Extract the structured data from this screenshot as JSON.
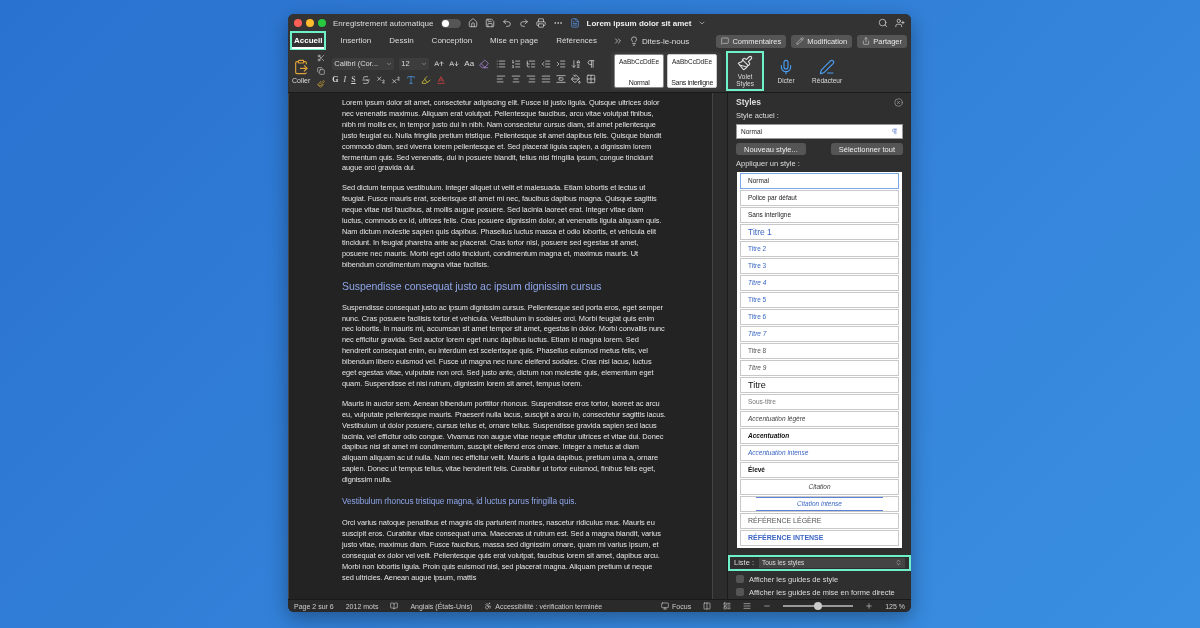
{
  "window": {
    "title": "Lorem ipsum dolor sit amet",
    "autosave_label": "Enregistrement automatique",
    "autosave_on": false
  },
  "ribbon_tabs": [
    {
      "label": "Accueil",
      "selected": true,
      "highlighted": true
    },
    {
      "label": "Insertion",
      "selected": false,
      "highlighted": false
    },
    {
      "label": "Dessin",
      "selected": false,
      "highlighted": false
    },
    {
      "label": "Conception",
      "selected": false,
      "highlighted": false
    },
    {
      "label": "Mise en page",
      "selected": false,
      "highlighted": false
    },
    {
      "label": "Références",
      "selected": false,
      "highlighted": false
    }
  ],
  "tell_me": "Dites-le-nous",
  "actions": [
    {
      "kind": "comments",
      "label": "Commentaires"
    },
    {
      "kind": "edit",
      "label": "Modification"
    },
    {
      "kind": "share",
      "label": "Partager"
    }
  ],
  "ribbon": {
    "paste_label": "Coller",
    "font_name": "Calibri (Cor...",
    "font_size": "12",
    "case_label": "Aa",
    "format_letters": [
      "G",
      "I",
      "S"
    ],
    "gallery": [
      {
        "preview": "AaBbCcDdEe",
        "label": "Normal",
        "selected": true
      },
      {
        "preview": "AaBbCcDdEe",
        "label": "Sans interligne",
        "selected": false
      }
    ],
    "tools": [
      {
        "kind": "styles",
        "label": "Volet Styles",
        "highlighted": true
      },
      {
        "kind": "dictate",
        "label": "Dicter",
        "highlighted": false
      },
      {
        "kind": "editor",
        "label": "Rédacteur",
        "highlighted": false
      }
    ]
  },
  "document": [
    {
      "kind": "body",
      "text": "Lorem ipsum dolor sit amet, consectetur adipiscing elit. Fusce id justo ligula. Quisque ultrices dolor nec venenatis maximus. Aliquam erat volutpat. Pellentesque faucibus, arcu vitae volutpat finibus, nibh mi mollis ex, in tempor justo dui in nibh. Nam consectetur cursus diam, sit amet pellentesque justo feugiat eu. Nulla fringilla pretium tristique. Pellentesque sit amet dapibus felis. Quisque blandit commodo diam, sed viverra lorem pellentesque et. Sed placerat ligula sapien, a dignissim lorem fermentum quis. Sed venenatis, dui in posuere blandit, tellus nisi fringilla ipsum, congue tincidunt augue orci gravida dui."
    },
    {
      "kind": "body",
      "text": "Sed dictum tempus vestibulum. Integer aliquet ut velit et malesuada. Etiam lobortis et lectus ut feugiat. Fusce mauris erat, scelerisque sit amet mi nec, faucibus dapibus magna. Quisque sagittis neque vitae nisl faucibus, at mollis augue posuere. Sed lacinia laoreet erat. Integer vitae diam luctus, commodo ex id, ultrices felis. Cras posuere dignissim dolor, at venenatis ligula aliquam quis. Nam dictum molestie sapien quis dapibus. Phasellus luctus massa et odio lobortis, et vehicula elit tincidunt. In feugiat pharetra ante ac placerat. Cras tortor nisl, posuere sed egestas sit amet, posuere nec mauris. Morbi eget odio tincidunt, condimentum magna et, maximus mauris. Ut bibendum condimentum magna vitae facilisis."
    },
    {
      "kind": "heading1",
      "text": "Suspendisse consequat justo ac ipsum dignissim cursus"
    },
    {
      "kind": "body",
      "text": "Suspendisse consequat justo ac ipsum dignissim cursus. Pellentesque sed porta eros, eget semper nunc. Cras posuere facilisis tortor et vehicula. Vestibulum in sodales orci. Morbi feugiat quis enim nec lobortis. In mauris mi, accumsan sit amet tempor sit amet, egestas in dolor. Morbi convallis nunc nec efficitur gravida. Sed auctor lorem eget nunc dapibus luctus. Etiam id magna lorem. Sed hendrerit consequat enim, eu interdum est scelerisque quis. Phasellus euismod metus felis, vel bibendum libero euismod vel. Fusce ut magna nec nunc eleifend sodales. Cras nisi lacus, luctus eget egestas vitae, vulputate non orci. Sed justo ante, dictum non molestie quis, elementum eget quam. Suspendisse et nisi rutrum, dignissim lorem sit amet, tempus lorem."
    },
    {
      "kind": "body",
      "text": "Mauris in auctor sem. Aenean bibendum porttitor rhoncus. Suspendisse eros tortor, laoreet ac arcu eu, vulputate pellentesque mauris. Praesent nulla lacus, suscipit a arcu in, consectetur sagittis lacus. Vestibulum ut dolor posuere, cursus tellus et, ornare tellus. Suspendisse gravida sapien sed lacus lacinia, vel efficitur odio congue. Vivamus non augue vitae neque efficitur ultrices et vitae dui. Donec dapibus nisi sit amet mi condimentum, suscipit eleifend eros ornare. Integer a metus at diam aliquam aliquam ac ut nulla. Nam nec efficitur velit. Mauris a ligula dapibus, pretium urna a, ornare sapien. Donec ut tempus tellus, vitae hendrerit felis. Curabitur ut tortor euismod, finibus felis eget, dignissim nulla."
    },
    {
      "kind": "heading2",
      "text": "Vestibulum rhoncus tristique magna, id luctus purus fringilla quis."
    },
    {
      "kind": "body",
      "text": "Orci varius natoque penatibus et magnis dis parturient montes, nascetur ridiculus mus. Mauris eu suscipit eros. Curabitur vitae consequat urna. Maecenas ut rutrum est. Sed a magna blandit, varius justo vitae, maximus diam. Fusce faucibus, massa sed dignissim ornare, quam mi varius ipsum, et consequat ex dolor vel velit. Pellentesque quis erat volutpat, faucibus lorem sit amet, dapibus arcu. Morbi non lobortis ligula. Proin quis euismod nisl, sed placerat magna. Aliquam pretium ut neque sed ultricies. Aenean augue ipsum, mattis"
    }
  ],
  "styles_pane": {
    "title": "Styles",
    "current_label": "Style actuel :",
    "current_value": "Normal",
    "buttons": [
      "Nouveau style...",
      "Sélectionner tout"
    ],
    "apply_label": "Appliquer un style :",
    "styles": [
      {
        "kind": "normal",
        "label": "Normal",
        "selected": true
      },
      {
        "kind": "normal",
        "label": "Police par défaut",
        "selected": false
      },
      {
        "kind": "normal",
        "label": "Sans interligne",
        "selected": false
      },
      {
        "kind": "heading1",
        "label": "Titre 1",
        "selected": false
      },
      {
        "kind": "heading",
        "label": "Titre 2",
        "selected": false
      },
      {
        "kind": "heading",
        "label": "Titre 3",
        "selected": false
      },
      {
        "kind": "heading-italic",
        "label": "Titre 4",
        "selected": false
      },
      {
        "kind": "heading",
        "label": "Titre 5",
        "selected": false
      },
      {
        "kind": "heading",
        "label": "Titre 6",
        "selected": false
      },
      {
        "kind": "heading-italic",
        "label": "Titre 7",
        "selected": false
      },
      {
        "kind": "grey",
        "label": "Titre 8",
        "selected": false
      },
      {
        "kind": "grey-italic",
        "label": "Titre 9",
        "selected": false
      },
      {
        "kind": "title",
        "label": "Titre",
        "selected": false
      },
      {
        "kind": "subtitle",
        "label": "Sous-titre",
        "selected": false
      },
      {
        "kind": "italic",
        "label": "Accentuation légère",
        "selected": false
      },
      {
        "kind": "bold-italic",
        "label": "Accentuation",
        "selected": false
      },
      {
        "kind": "blue-italic",
        "label": "Accentuation intense",
        "selected": false
      },
      {
        "kind": "bold",
        "label": "Élevé",
        "selected": false
      },
      {
        "kind": "quote",
        "label": "Citation",
        "selected": false
      },
      {
        "kind": "quote-intense",
        "label": "Citation intense",
        "selected": false
      },
      {
        "kind": "ref",
        "label": "RÉFÉRENCE LÉGÈRE",
        "selected": false
      },
      {
        "kind": "ref-intense",
        "label": "RÉFÉRENCE INTENSE",
        "selected": false
      }
    ],
    "list_label": "Liste :",
    "list_value": "Tous les styles",
    "list_highlighted": true,
    "options": [
      {
        "label": "Afficher les guides de style",
        "checked": false
      },
      {
        "label": "Afficher les guides de mise en forme directe",
        "checked": false
      }
    ]
  },
  "status_bar": {
    "page": "Page 2 sur 6",
    "words": "2012 mots",
    "language": "Anglais (États-Unis)",
    "accessibility": "Accessibilité : vérification terminée",
    "focus": "Focus",
    "zoom": {
      "level": 0.5
    },
    "zoom_reading": "125 %"
  }
}
